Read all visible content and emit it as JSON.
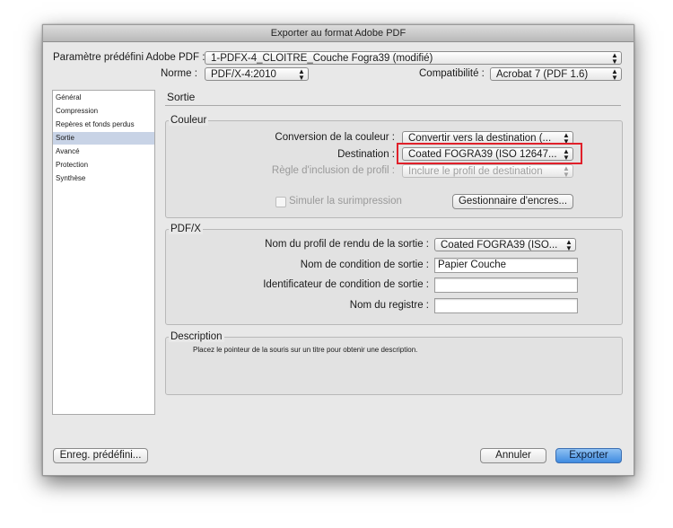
{
  "window": {
    "title": "Exporter au format Adobe PDF"
  },
  "preset": {
    "label": "Paramètre prédéfini Adobe PDF :",
    "value": "1-PDFX-4_CLOITRE_Couche Fogra39 (modifié)"
  },
  "standard": {
    "label": "Norme :",
    "value": "PDF/X-4:2010"
  },
  "compatibility": {
    "label": "Compatibilité :",
    "value": "Acrobat 7 (PDF 1.6)"
  },
  "sidebar": {
    "items": [
      {
        "label": "Général"
      },
      {
        "label": "Compression"
      },
      {
        "label": "Repères et fonds perdus"
      },
      {
        "label": "Sortie"
      },
      {
        "label": "Avancé"
      },
      {
        "label": "Protection"
      },
      {
        "label": "Synthèse"
      }
    ]
  },
  "section": {
    "title": "Sortie"
  },
  "color": {
    "group_title": "Couleur",
    "conversion_label": "Conversion de la couleur :",
    "conversion_value": "Convertir vers la destination (...",
    "destination_label": "Destination :",
    "destination_value": "Coated FOGRA39 (ISO 12647...",
    "profile_rule_label": "Règle d'inclusion de profil :",
    "profile_rule_value": "Inclure le profil de destination",
    "simulate_label": "Simuler la surimpression",
    "ink_manager_label": "Gestionnaire d'encres..."
  },
  "pdfx": {
    "group_title": "PDF/X",
    "output_profile_label": "Nom du profil de rendu de la sortie :",
    "output_profile_value": "Coated FOGRA39 (ISO...",
    "output_condition_name_label": "Nom de condition de sortie :",
    "output_condition_name_value": "Papier Couche",
    "output_condition_id_label": "Identificateur de condition de sortie :",
    "output_condition_id_value": "",
    "registry_label": "Nom du registre :",
    "registry_value": ""
  },
  "description": {
    "group_title": "Description",
    "text": "Placez le pointeur de la souris sur un titre pour obtenir une description."
  },
  "footer": {
    "save_preset": "Enreg. prédéfini...",
    "cancel": "Annuler",
    "export": "Exporter"
  }
}
